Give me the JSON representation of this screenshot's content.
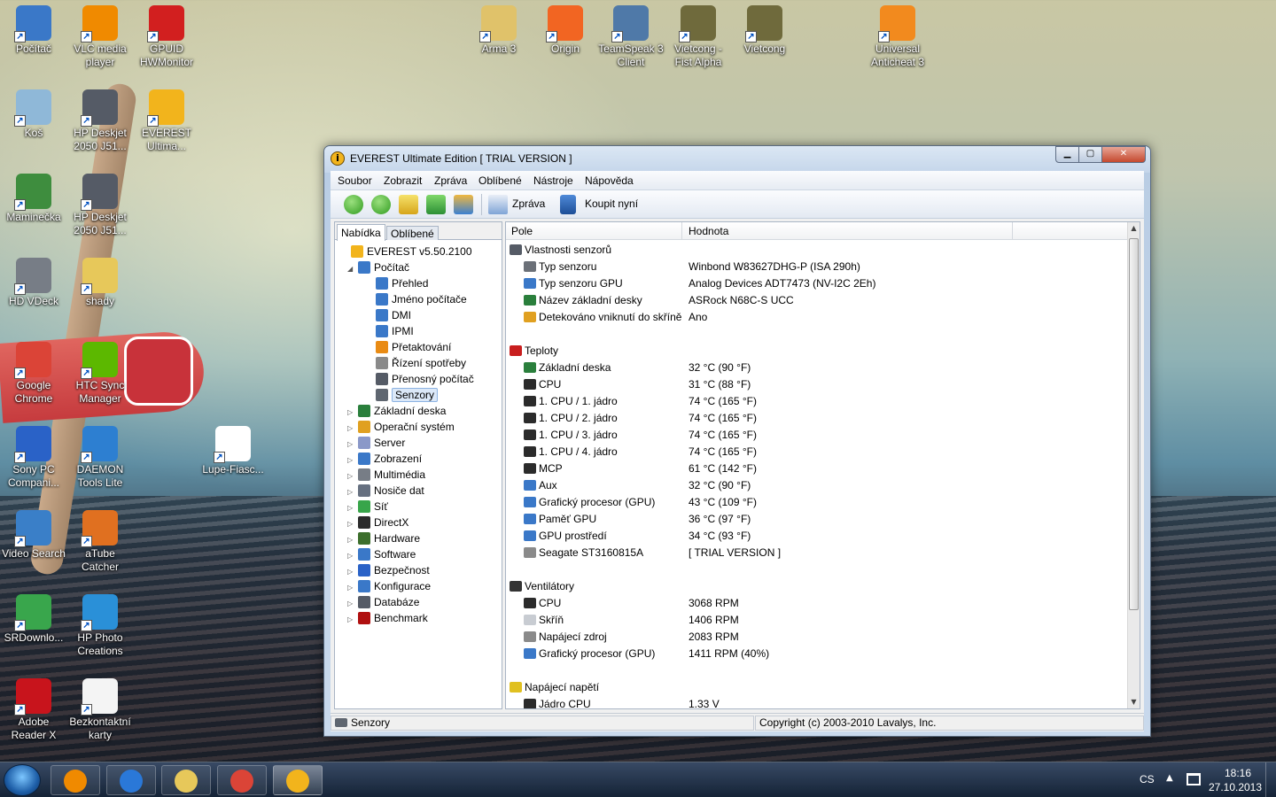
{
  "desktop": {
    "icons": [
      {
        "label": "Počítač",
        "color": "#3a78c8"
      },
      {
        "label": "VLC media player",
        "color": "#f08a00"
      },
      {
        "label": "GPUID HWMonitor",
        "color": "#d21f1f"
      },
      {
        "label": "Koš",
        "color": "#8fb8d8"
      },
      {
        "label": "HP Deskjet 2050 J51...",
        "color": "#555b66"
      },
      {
        "label": "EVEREST Ultima...",
        "color": "#f2b41c"
      },
      {
        "label": "Maminečka",
        "color": "#3e8d3e"
      },
      {
        "label": "HP Deskjet 2050 J51...",
        "color": "#555b66"
      },
      {
        "label": "HD VDeck",
        "color": "#777d86"
      },
      {
        "label": "shady",
        "color": "#e7c85a"
      },
      {
        "label": "Google Chrome",
        "color": "#db4437"
      },
      {
        "label": "HTC Sync Manager",
        "color": "#5cb800"
      },
      {
        "label": "Sony PC Compani...",
        "color": "#2a62c7"
      },
      {
        "label": "DAEMON Tools Lite",
        "color": "#2d7fd1"
      },
      {
        "label": "Lupe-Fiasc...",
        "color": "#ffffff"
      },
      {
        "label": "Video Search",
        "color": "#3a7fc8"
      },
      {
        "label": "aTube Catcher",
        "color": "#e07020"
      },
      {
        "label": "SRDownlo...",
        "color": "#39a64c"
      },
      {
        "label": "HP Photo Creations",
        "color": "#2a90d8"
      },
      {
        "label": "Adobe Reader X",
        "color": "#c8141c"
      },
      {
        "label": "Bezkontaktní karty",
        "color": "#f4f4f4"
      },
      {
        "label": "Arma 3",
        "color": "#e0c26a"
      },
      {
        "label": "Origin",
        "color": "#f26522"
      },
      {
        "label": "TeamSpeak 3 Client",
        "color": "#4f79a8"
      },
      {
        "label": "Vietcong - Fist Alpha",
        "color": "#6f6a3c"
      },
      {
        "label": "Vietcong",
        "color": "#6f6a3c"
      },
      {
        "label": "Universal Anticheat 3",
        "color": "#f28a1e"
      }
    ]
  },
  "window": {
    "title": "EVEREST Ultimate Edition  [ TRIAL VERSION ]",
    "controls": {
      "minimize": "▁",
      "maximize": "▢",
      "close": "✕"
    }
  },
  "menu": [
    "Soubor",
    "Zobrazit",
    "Zpráva",
    "Oblíbené",
    "Nástroje",
    "Nápověda"
  ],
  "toolbar": {
    "report": "Zpráva",
    "buy": "Koupit nyní"
  },
  "tabs": {
    "menu": "Nabídka",
    "favorites": "Oblíbené"
  },
  "tree": [
    {
      "label": "EVEREST v5.50.2100",
      "level": 0,
      "exp": "",
      "color": "#f2b41c"
    },
    {
      "label": "Počítač",
      "level": 1,
      "exp": "◢",
      "color": "#3a78c8"
    },
    {
      "label": "Přehled",
      "level": 2,
      "exp": "",
      "color": "#3a78c8"
    },
    {
      "label": "Jméno počítače",
      "level": 2,
      "exp": "",
      "color": "#3a78c8"
    },
    {
      "label": "DMI",
      "level": 2,
      "exp": "",
      "color": "#3a78c8"
    },
    {
      "label": "IPMI",
      "level": 2,
      "exp": "",
      "color": "#3a78c8"
    },
    {
      "label": "Přetaktování",
      "level": 2,
      "exp": "",
      "color": "#e98b14"
    },
    {
      "label": "Řízení spotřeby",
      "level": 2,
      "exp": "",
      "color": "#8a8a8a"
    },
    {
      "label": "Přenosný počítač",
      "level": 2,
      "exp": "",
      "color": "#555b66"
    },
    {
      "label": "Senzory",
      "level": 2,
      "exp": "",
      "color": "#5f6670",
      "selected": true
    },
    {
      "label": "Základní deska",
      "level": 1,
      "exp": "▷",
      "color": "#2a7f3c"
    },
    {
      "label": "Operační systém",
      "level": 1,
      "exp": "▷",
      "color": "#e0a020"
    },
    {
      "label": "Server",
      "level": 1,
      "exp": "▷",
      "color": "#8a98c8"
    },
    {
      "label": "Zobrazení",
      "level": 1,
      "exp": "▷",
      "color": "#3a78c8"
    },
    {
      "label": "Multimédia",
      "level": 1,
      "exp": "▷",
      "color": "#777d86"
    },
    {
      "label": "Nosiče dat",
      "level": 1,
      "exp": "▷",
      "color": "#667080"
    },
    {
      "label": "Síť",
      "level": 1,
      "exp": "▷",
      "color": "#38a54a"
    },
    {
      "label": "DirectX",
      "level": 1,
      "exp": "▷",
      "color": "#2b2b2b"
    },
    {
      "label": "Hardware",
      "level": 1,
      "exp": "▷",
      "color": "#3c6e2c"
    },
    {
      "label": "Software",
      "level": 1,
      "exp": "▷",
      "color": "#3a78c8"
    },
    {
      "label": "Bezpečnost",
      "level": 1,
      "exp": "▷",
      "color": "#2a62c7"
    },
    {
      "label": "Konfigurace",
      "level": 1,
      "exp": "▷",
      "color": "#3a78c8"
    },
    {
      "label": "Databáze",
      "level": 1,
      "exp": "▷",
      "color": "#555b66"
    },
    {
      "label": "Benchmark",
      "level": 1,
      "exp": "▷",
      "color": "#b01010"
    }
  ],
  "columns": {
    "field": "Pole",
    "value": "Hodnota"
  },
  "rows": [
    {
      "type": "group",
      "field": "Vlastnosti senzorů",
      "value": "",
      "color": "#555b66"
    },
    {
      "type": "item",
      "field": "Typ senzoru",
      "value": "Winbond W83627DHG-P  (ISA 290h)",
      "color": "#6b7078"
    },
    {
      "type": "item",
      "field": "Typ senzoru GPU",
      "value": "Analog Devices ADT7473  (NV-I2C 2Eh)",
      "color": "#3a78c8"
    },
    {
      "type": "item",
      "field": "Název základní desky",
      "value": "ASRock N68C-S UCC",
      "color": "#2a7f3c"
    },
    {
      "type": "item",
      "field": "Detekováno vniknutí do skříně",
      "value": "Ano",
      "color": "#e0a020"
    },
    {
      "type": "blank"
    },
    {
      "type": "group",
      "field": "Teploty",
      "value": "",
      "color": "#c81e1e"
    },
    {
      "type": "item",
      "field": "Základní deska",
      "value": "32 °C  (90 °F)",
      "color": "#2a7f3c"
    },
    {
      "type": "item",
      "field": "CPU",
      "value": "31 °C  (88 °F)",
      "color": "#2b2b2b"
    },
    {
      "type": "item",
      "field": "1. CPU / 1. jádro",
      "value": "74 °C  (165 °F)",
      "color": "#2b2b2b"
    },
    {
      "type": "item",
      "field": "1. CPU / 2. jádro",
      "value": "74 °C  (165 °F)",
      "color": "#2b2b2b"
    },
    {
      "type": "item",
      "field": "1. CPU / 3. jádro",
      "value": "74 °C  (165 °F)",
      "color": "#2b2b2b"
    },
    {
      "type": "item",
      "field": "1. CPU / 4. jádro",
      "value": "74 °C  (165 °F)",
      "color": "#2b2b2b"
    },
    {
      "type": "item",
      "field": "MCP",
      "value": "61 °C  (142 °F)",
      "color": "#2b2b2b"
    },
    {
      "type": "item",
      "field": "Aux",
      "value": "32 °C  (90 °F)",
      "color": "#3a78c8"
    },
    {
      "type": "item",
      "field": "Grafický procesor (GPU)",
      "value": "43 °C  (109 °F)",
      "color": "#3a78c8"
    },
    {
      "type": "item",
      "field": "Paměť GPU",
      "value": "36 °C  (97 °F)",
      "color": "#3a78c8"
    },
    {
      "type": "item",
      "field": "GPU prostředí",
      "value": "34 °C  (93 °F)",
      "color": "#3a78c8"
    },
    {
      "type": "item",
      "field": "Seagate ST3160815A",
      "value": "[ TRIAL VERSION ]",
      "color": "#8a8a8a"
    },
    {
      "type": "blank"
    },
    {
      "type": "group",
      "field": "Ventilátory",
      "value": "",
      "color": "#333333"
    },
    {
      "type": "item",
      "field": "CPU",
      "value": "3068 RPM",
      "color": "#2b2b2b"
    },
    {
      "type": "item",
      "field": "Skříň",
      "value": "1406 RPM",
      "color": "#c8ccd2"
    },
    {
      "type": "item",
      "field": "Napájecí zdroj",
      "value": "2083 RPM",
      "color": "#8a8a8a"
    },
    {
      "type": "item",
      "field": "Grafický procesor (GPU)",
      "value": "1411 RPM  (40%)",
      "color": "#3a78c8"
    },
    {
      "type": "blank"
    },
    {
      "type": "group",
      "field": "Napájecí napětí",
      "value": "",
      "color": "#e0c020"
    },
    {
      "type": "item",
      "field": "Jádro CPU",
      "value": "1.33 V",
      "color": "#2b2b2b"
    }
  ],
  "status": {
    "left": "Senzory",
    "right": "Copyright (c) 2003-2010 Lavalys, Inc."
  },
  "taskbar": {
    "apps": [
      {
        "name": "media-player",
        "color": "#f08a00"
      },
      {
        "name": "internet-explorer",
        "color": "#2a78d8"
      },
      {
        "name": "explorer",
        "color": "#e7c85a"
      },
      {
        "name": "chrome",
        "color": "#db4437"
      },
      {
        "name": "everest",
        "color": "#f2b41c"
      }
    ],
    "lang": "CS",
    "tray_arrow": "▲",
    "time": "18:16",
    "date": "27.10.2013"
  }
}
